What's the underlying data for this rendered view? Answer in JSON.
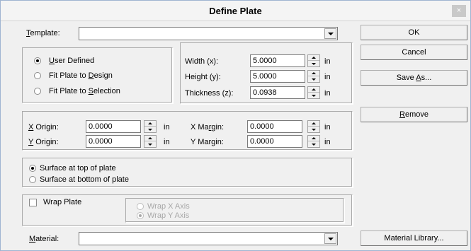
{
  "window": {
    "title": "Define Plate",
    "close_glyph": "×"
  },
  "template": {
    "label_u": "T",
    "label_rest": "emplate:",
    "value": ""
  },
  "buttons": {
    "ok": "OK",
    "cancel": "Cancel",
    "save_as_pre": "Save ",
    "save_as_u": "A",
    "save_as_post": "s...",
    "remove_u": "R",
    "remove_rest": "emove",
    "material_library": "Material Library..."
  },
  "plate_mode": {
    "selected": "user_defined",
    "options": [
      {
        "id": "user_defined",
        "pre": "",
        "u": "U",
        "post": "ser Defined"
      },
      {
        "id": "fit_design",
        "pre": "Fit Plate to ",
        "u": "D",
        "post": "esign"
      },
      {
        "id": "fit_selection",
        "pre": "Fit Plate to ",
        "u": "S",
        "post": "election"
      }
    ]
  },
  "dimensions": {
    "width": {
      "label": "Width (x):",
      "value": "5.0000",
      "unit": "in"
    },
    "height": {
      "label": "Height (y):",
      "value": "5.0000",
      "unit": "in"
    },
    "thickness": {
      "label": "Thickness (z):",
      "value": "0.0938",
      "unit": "in"
    }
  },
  "origin": {
    "x_origin": {
      "label_u": "X",
      "label_rest": " Origin:",
      "value": "0.0000",
      "unit": "in"
    },
    "y_origin": {
      "label_u": "Y",
      "label_rest": " Origin:",
      "value": "0.0000",
      "unit": "in"
    },
    "x_margin": {
      "label_pre": "X Ma",
      "label_u": "r",
      "label_post": "gin:",
      "value": "0.0000",
      "unit": "in"
    },
    "y_margin": {
      "label": "Y Margin:",
      "value": "0.0000",
      "unit": "in"
    }
  },
  "surface": {
    "selected": "top",
    "top": "Surface at top of plate",
    "bottom": "Surface at bottom of plate"
  },
  "wrap": {
    "checked": false,
    "label": "Wrap Plate",
    "x_axis": "Wrap X Axis",
    "y_axis": "Wrap Y Axis",
    "selected_axis": "y"
  },
  "material": {
    "label_u": "M",
    "label_rest": "aterial:",
    "value": ""
  }
}
